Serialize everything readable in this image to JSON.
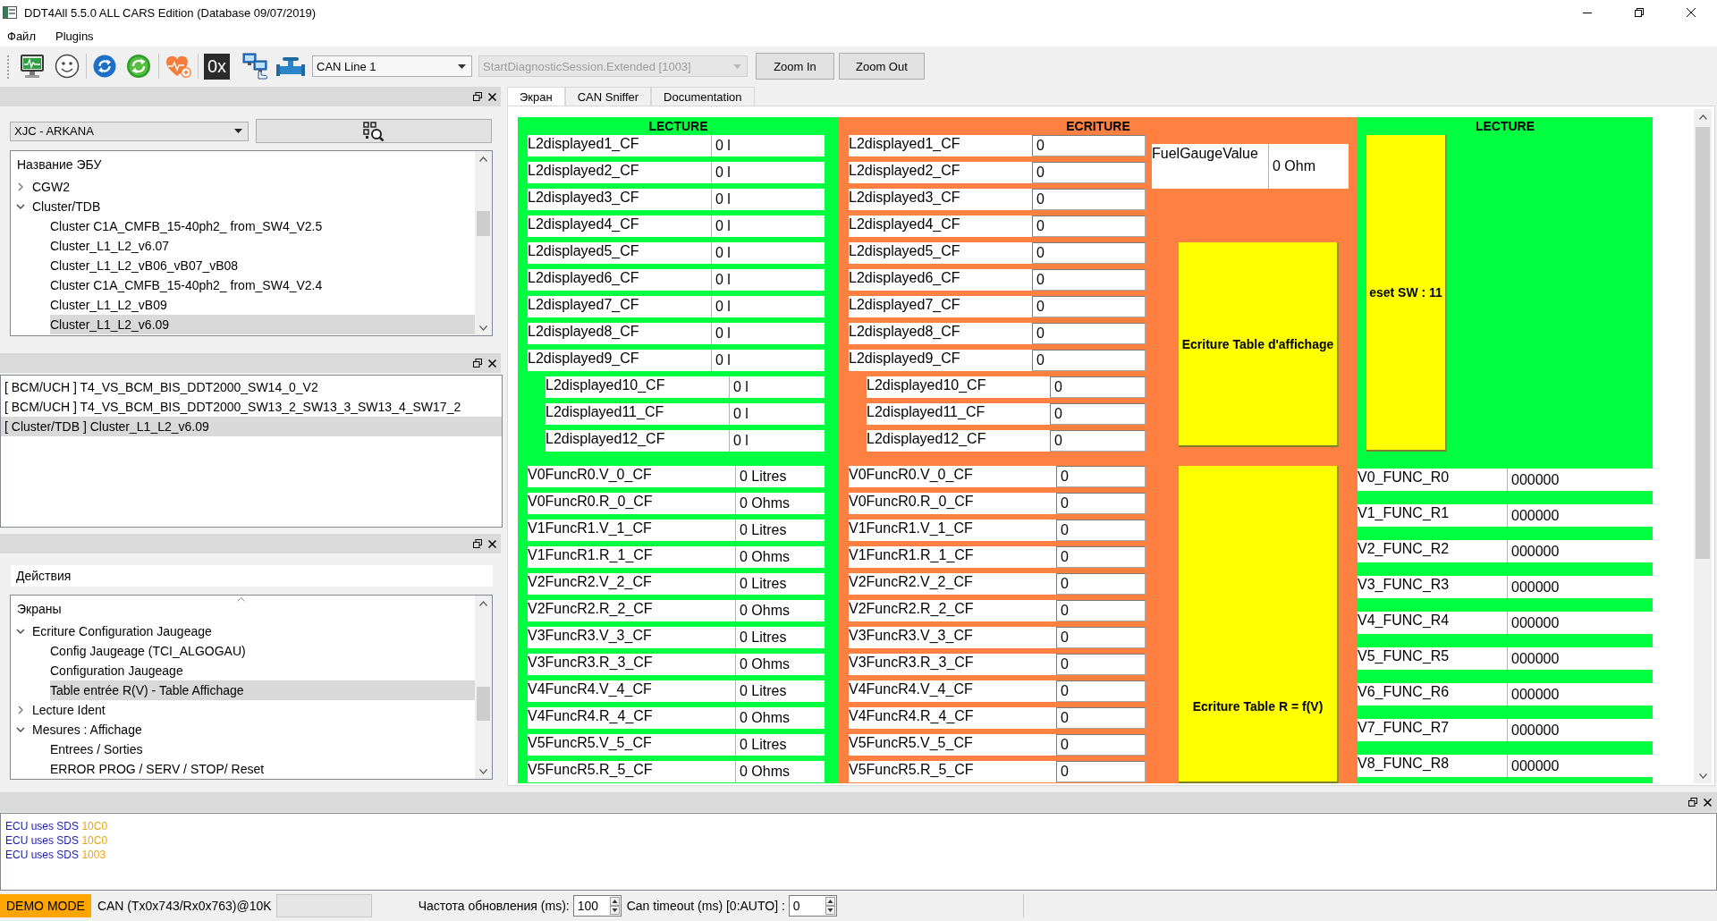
{
  "window": {
    "title": "DDT4All 5.5.0 ALL CARS Edition (Database 09/07/2019)"
  },
  "menu": [
    "Файл",
    "Plugins"
  ],
  "toolbar": {
    "hex_label": "0x",
    "can_line": "CAN Line 1",
    "session": {
      "value": "StartDiagnosticSession.Extended [1003]",
      "disabled": true
    },
    "buttons": [
      "Zoom In",
      "Zoom Out"
    ]
  },
  "ecu_panel": {
    "vehicle": "XJC - ARKANA",
    "tree": {
      "header": "Название ЭБУ",
      "items": [
        {
          "label": "CGW2",
          "expanded": false,
          "selected": false
        },
        {
          "label": "Cluster/TDB",
          "expanded": true,
          "selected": false,
          "children": [
            {
              "label": "Cluster C1A_CMFB_15-40ph2_ from_SW4_V2.5",
              "selected": false
            },
            {
              "label": "Cluster_L1_L2_v6.07",
              "selected": false
            },
            {
              "label": "Cluster_L1_L2_vB06_vB07_vB08",
              "selected": false
            },
            {
              "label": "Cluster C1A_CMFB_15-40ph2_ from_SW4_V2.4",
              "selected": false
            },
            {
              "label": "Cluster_L1_L2_vB09",
              "selected": false
            },
            {
              "label": "Cluster_L1_L2_v6.09",
              "selected": true
            }
          ]
        }
      ]
    }
  },
  "ecu_list": {
    "items": [
      {
        "label": "[ BCM/UCH ] T4_VS_BCM_BIS_DDT2000_SW14_0_V2",
        "selected": false
      },
      {
        "label": "[ BCM/UCH ] T4_VS_BCM_BIS_DDT2000_SW13_2_SW13_3_SW13_4_SW17_2",
        "selected": false
      },
      {
        "label": "[ Cluster/TDB ] Cluster_L1_L2_v6.09",
        "selected": true
      }
    ]
  },
  "screens_panel": {
    "title": "Действия",
    "tree": {
      "header": "Экраны",
      "sorted": true,
      "items": [
        {
          "label": "Ecriture Configuration Jaugeage",
          "expanded": true,
          "selected": false,
          "children": [
            {
              "label": "Config Jaugeage (TCI_ALGOGAU)",
              "selected": false
            },
            {
              "label": "Configuration Jaugeage",
              "selected": false
            },
            {
              "label": "Table entrée R(V) - Table Affichage",
              "selected": true
            }
          ]
        },
        {
          "label": "Lecture Ident",
          "expanded": false,
          "selected": false
        },
        {
          "label": "Mesures : Affichage",
          "expanded": true,
          "selected": false,
          "children": [
            {
              "label": "Entrees / Sorties",
              "selected": false
            },
            {
              "label": "ERROR PROG / SERV / STOP/ Reset",
              "selected": false
            }
          ]
        }
      ]
    }
  },
  "tabs": [
    {
      "label": "Экран",
      "selected": true
    },
    {
      "label": "CAN Sniffer",
      "selected": false
    },
    {
      "label": "Documentation",
      "selected": false
    }
  ],
  "screen": {
    "panels": [
      {
        "kind": "form",
        "title": "LECTURE",
        "color": "#00ff40",
        "editable": false,
        "groups": [
          {
            "kind": "standard",
            "rows": [
              {
                "label": "L2displayed1_CF",
                "value": "0 l"
              },
              {
                "label": "L2displayed2_CF",
                "value": "0 l"
              },
              {
                "label": "L2displayed3_CF",
                "value": "0 l"
              },
              {
                "label": "L2displayed4_CF",
                "value": "0 l"
              },
              {
                "label": "L2displayed5_CF",
                "value": "0 l"
              },
              {
                "label": "L2displayed6_CF",
                "value": "0 l"
              },
              {
                "label": "L2displayed7_CF",
                "value": "0 l"
              },
              {
                "label": "L2displayed8_CF",
                "value": "0 l"
              },
              {
                "label": "L2displayed9_CF",
                "value": "0 l"
              }
            ]
          },
          {
            "kind": "indented",
            "rows": [
              {
                "label": "L2displayed10_CF",
                "value": "0 l"
              },
              {
                "label": "L2displayed11_CF",
                "value": "0 l"
              },
              {
                "label": "L2displayed12_CF",
                "value": "0 l"
              }
            ]
          },
          {
            "kind": "long_label",
            "rows": [
              {
                "label": "V0FuncR0.V_0_CF",
                "value": "0 Litres"
              },
              {
                "label": "V0FuncR0.R_0_CF",
                "value": "0 Ohms"
              },
              {
                "label": "V1FuncR1.V_1_CF",
                "value": "0 Litres"
              },
              {
                "label": "V1FuncR1.R_1_CF",
                "value": "0 Ohms"
              },
              {
                "label": "V2FuncR2.V_2_CF",
                "value": "0 Litres"
              },
              {
                "label": "V2FuncR2.R_2_CF",
                "value": "0 Ohms"
              },
              {
                "label": "V3FuncR3.V_3_CF",
                "value": "0 Litres"
              },
              {
                "label": "V3FuncR3.R_3_CF",
                "value": "0 Ohms"
              },
              {
                "label": "V4FuncR4.V_4_CF",
                "value": "0 Litres"
              },
              {
                "label": "V4FuncR4.R_4_CF",
                "value": "0 Ohms"
              },
              {
                "label": "V5FuncR5.V_5_CF",
                "value": "0 Litres"
              },
              {
                "label": "V5FuncR5.R_5_CF",
                "value": "0 Ohms"
              }
            ]
          }
        ]
      },
      {
        "kind": "form",
        "title": "ECRITURE",
        "color": "#ff8040",
        "editable": true,
        "groups": [
          {
            "kind": "standard",
            "rows": [
              {
                "label": "L2displayed1_CF",
                "value": "0"
              },
              {
                "label": "L2displayed2_CF",
                "value": "0"
              },
              {
                "label": "L2displayed3_CF",
                "value": "0"
              },
              {
                "label": "L2displayed4_CF",
                "value": "0"
              },
              {
                "label": "L2displayed5_CF",
                "value": "0"
              },
              {
                "label": "L2displayed6_CF",
                "value": "0"
              },
              {
                "label": "L2displayed7_CF",
                "value": "0"
              },
              {
                "label": "L2displayed8_CF",
                "value": "0"
              },
              {
                "label": "L2displayed9_CF",
                "value": "0"
              }
            ]
          },
          {
            "kind": "indented",
            "rows": [
              {
                "label": "L2displayed10_CF",
                "value": "0"
              },
              {
                "label": "L2displayed11_CF",
                "value": "0"
              },
              {
                "label": "L2displayed12_CF",
                "value": "0"
              }
            ]
          },
          {
            "kind": "long_label",
            "rows": [
              {
                "label": "V0FuncR0.V_0_CF",
                "value": "0"
              },
              {
                "label": "V0FuncR0.R_0_CF",
                "value": "0"
              },
              {
                "label": "V1FuncR1.V_1_CF",
                "value": "0"
              },
              {
                "label": "V1FuncR1.R_1_CF",
                "value": "0"
              },
              {
                "label": "V2FuncR2.V_2_CF",
                "value": "0"
              },
              {
                "label": "V2FuncR2.R_2_CF",
                "value": "0"
              },
              {
                "label": "V3FuncR3.V_3_CF",
                "value": "0"
              },
              {
                "label": "V3FuncR3.R_3_CF",
                "value": "0"
              },
              {
                "label": "V4FuncR4.V_4_CF",
                "value": "0"
              },
              {
                "label": "V4FuncR4.R_4_CF",
                "value": "0"
              },
              {
                "label": "V5FuncR5.V_5_CF",
                "value": "0"
              },
              {
                "label": "V5FuncR5.R_5_CF",
                "value": "0"
              }
            ]
          }
        ],
        "side": {
          "gauge": {
            "label": "FuelGaugeValue",
            "value": "0 Ohm"
          },
          "buttons": [
            "Ecriture Table d'affichage",
            "Ecriture Table R = f(V)"
          ]
        }
      },
      {
        "kind": "list",
        "title": "LECTURE",
        "color": "#00ff40",
        "editable": false,
        "button": "eset SW : 11",
        "rows": [
          {
            "label": "V0_FUNC_R0",
            "value": "000000"
          },
          {
            "label": "V1_FUNC_R1",
            "value": "000000"
          },
          {
            "label": "V2_FUNC_R2",
            "value": "000000"
          },
          {
            "label": "V3_FUNC_R3",
            "value": "000000"
          },
          {
            "label": "V4_FUNC_R4",
            "value": "000000"
          },
          {
            "label": "V5_FUNC_R5",
            "value": "000000"
          },
          {
            "label": "V6_FUNC_R6",
            "value": "000000"
          },
          {
            "label": "V7_FUNC_R7",
            "value": "000000"
          },
          {
            "label": "V8_FUNC_R8",
            "value": "000000"
          }
        ]
      }
    ]
  },
  "log": {
    "lines": [
      {
        "message": "ECU uses SDS",
        "code": "10C0"
      },
      {
        "message": "ECU uses SDS",
        "code": "10C0"
      },
      {
        "message": "ECU uses SDS",
        "code": "1003"
      }
    ]
  },
  "status_bar": {
    "mode": "DEMO MODE",
    "connection": "CAN (Tx0x743/Rx0x763)@10K",
    "refresh_label": "Частота обновления (ms):",
    "refresh_value": "100",
    "timeout_label": "Can timeout (ms) [0:AUTO] :",
    "timeout_value": "0"
  }
}
